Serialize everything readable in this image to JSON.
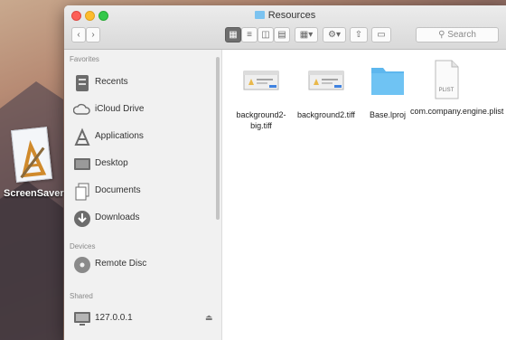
{
  "desktop": {
    "icon_label": "ScreenSaver"
  },
  "window": {
    "title": "Resources",
    "search_placeholder": "Search"
  },
  "sidebar": {
    "favorites_label": "Favorites",
    "devices_label": "Devices",
    "shared_label": "Shared",
    "favorites": [
      {
        "label": "Recents",
        "icon": "recents-icon"
      },
      {
        "label": "iCloud Drive",
        "icon": "cloud-icon"
      },
      {
        "label": "Applications",
        "icon": "applications-icon"
      },
      {
        "label": "Desktop",
        "icon": "desktop-icon"
      },
      {
        "label": "Documents",
        "icon": "documents-icon"
      },
      {
        "label": "Downloads",
        "icon": "downloads-icon"
      }
    ],
    "devices": [
      {
        "label": "Remote Disc",
        "icon": "disc-icon"
      }
    ],
    "shared": [
      {
        "label": "127.0.0.1",
        "icon": "monitor-icon"
      }
    ]
  },
  "files": [
    {
      "name": "background2-big.tiff",
      "type": "image"
    },
    {
      "name": "background2.tiff",
      "type": "image"
    },
    {
      "name": "Base.lproj",
      "type": "folder"
    },
    {
      "name": "com.company.engine.plist",
      "type": "plist",
      "badge": "PLIST"
    }
  ]
}
